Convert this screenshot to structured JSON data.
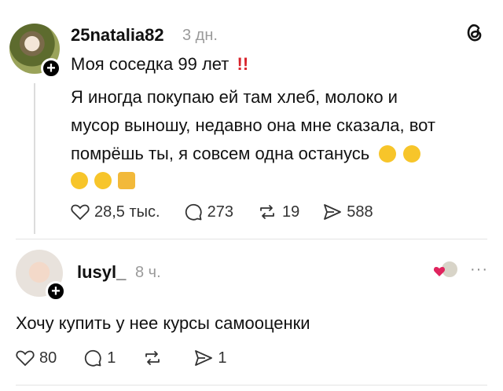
{
  "post": {
    "username": "25natalia82",
    "time": "3 дн.",
    "title_line": "Моя соседка 99 лет",
    "title_emoji": "‼️",
    "lines": [
      "Я иногда покупаю ей там хлеб, молоко и",
      "мусор выношу, недавно она мне сказала, вот",
      "помрёшь ты, я совсем одна останусь"
    ],
    "emojis_inline": [
      "grinning",
      "zany"
    ],
    "emojis_next": [
      "joy",
      "rofl",
      "thumbs-up"
    ],
    "likes": "28,5 тыс.",
    "replies": "273",
    "reposts": "19",
    "shares": "588"
  },
  "reply": {
    "username": "lusyl_",
    "time": "8 ч.",
    "text": "Хочу купить у нее курсы самооценки",
    "likes": "80",
    "replies": "1",
    "shares": "1"
  },
  "header": {
    "logo_icon": "threads-logo-icon"
  },
  "colors": {
    "muted": "#9a9a9a",
    "like_red": "#e0245e",
    "thread_line": "#dcdcdc"
  }
}
